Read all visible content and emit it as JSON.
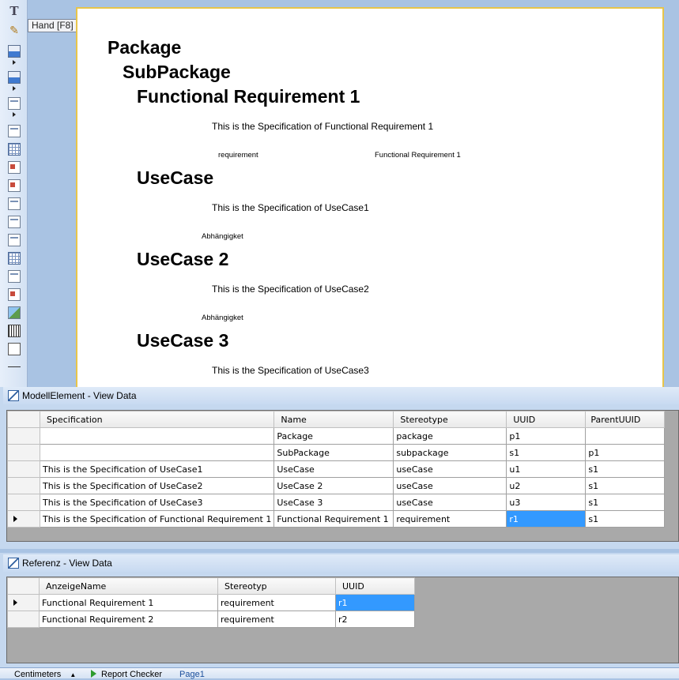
{
  "toolbox": {
    "tooltip": "Hand [F8]"
  },
  "report": {
    "package": "Package",
    "subpackage": "SubPackage",
    "fr1_heading": "Functional Requirement 1",
    "fr1_spec": "This is the Specification of Functional Requirement 1",
    "fr1_stereotype": "requirement",
    "fr1_name": "Functional Requirement 1",
    "uc1_heading": "UseCase",
    "uc1_spec": "This is the Specification of UseCase1",
    "uc1_dep": "Abhängigket",
    "uc2_heading": "UseCase 2",
    "uc2_spec": "This is the Specification of UseCase2",
    "uc2_dep": "Abhängigket",
    "uc3_heading": "UseCase 3",
    "uc3_spec": "This is the Specification of UseCase3"
  },
  "modell_panel": {
    "title": "ModellElement - View Data",
    "columns": [
      "Specification",
      "Name",
      "Stereotype",
      "UUID",
      "ParentUUID"
    ],
    "rows": [
      {
        "spec": "",
        "name": "Package",
        "stereotype": "package",
        "uuid": "p1",
        "parent": ""
      },
      {
        "spec": "",
        "name": "SubPackage",
        "stereotype": "subpackage",
        "uuid": "s1",
        "parent": "p1"
      },
      {
        "spec": "This is the Specification of UseCase1",
        "name": "UseCase",
        "stereotype": "useCase",
        "uuid": "u1",
        "parent": "s1"
      },
      {
        "spec": "This is the Specification of UseCase2",
        "name": "UseCase 2",
        "stereotype": "useCase",
        "uuid": "u2",
        "parent": "s1"
      },
      {
        "spec": "This is the Specification of UseCase3",
        "name": "UseCase 3",
        "stereotype": "useCase",
        "uuid": "u3",
        "parent": "s1"
      },
      {
        "spec": "This is the Specification of Functional Requirement 1",
        "name": "Functional Requirement 1",
        "stereotype": "requirement",
        "uuid": "r1",
        "parent": "s1"
      }
    ]
  },
  "referenz_panel": {
    "title": "Referenz - View Data",
    "columns": [
      "AnzeigeName",
      "Stereotyp",
      "UUID"
    ],
    "rows": [
      {
        "name": "Functional Requirement 1",
        "stereotyp": "requirement",
        "uuid": "r1"
      },
      {
        "name": "Functional Requirement 2",
        "stereotyp": "requirement",
        "uuid": "r2"
      }
    ]
  },
  "statusbar": {
    "units": "Centimeters",
    "checker": "Report Checker",
    "page": "Page1"
  },
  "colors": {
    "selection": "#3399ff",
    "page_border": "#e8c54a",
    "frame_bg": "#a9c3e3"
  }
}
